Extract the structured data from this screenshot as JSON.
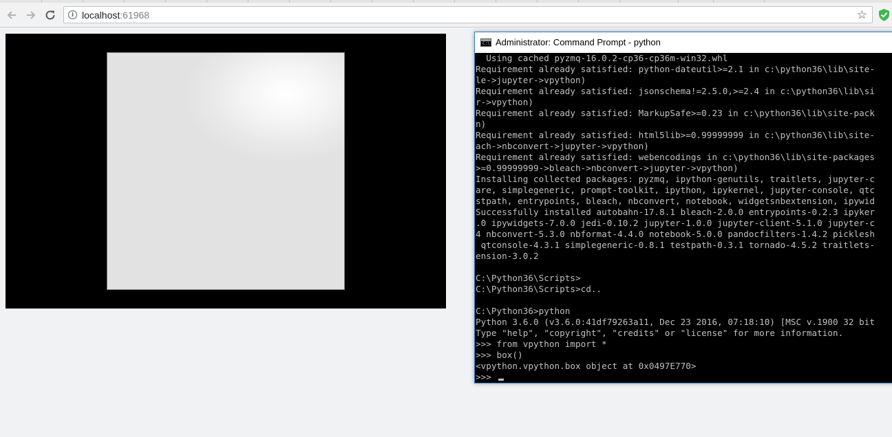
{
  "browser": {
    "address": {
      "host": "localhost",
      "port": ":61968"
    },
    "icons": {
      "back": "arrow-left-icon",
      "forward": "arrow-right-icon",
      "reload": "reload-icon",
      "info": "info-icon",
      "star": "star-icon",
      "extension": "shield-check-icon"
    }
  },
  "vpython_scene": {
    "background_color": "#000000",
    "object": "box",
    "object_color": "#e4e4e4"
  },
  "console": {
    "title": "Administrator: Command Prompt - python",
    "lines": [
      "  Using cached pyzmq-16.0.2-cp36-cp36m-win32.whl",
      "Requirement already satisfied: python-dateutil>=2.1 in c:\\python36\\lib\\site-",
      "le->jupyter->vpython)",
      "Requirement already satisfied: jsonschema!=2.5.0,>=2.4 in c:\\python36\\lib\\si",
      "r->vpython)",
      "Requirement already satisfied: MarkupSafe>=0.23 in c:\\python36\\lib\\site-pack",
      "n)",
      "Requirement already satisfied: html5lib>=0.99999999 in c:\\python36\\lib\\site-",
      "ach->nbconvert->jupyter->vpython)",
      "Requirement already satisfied: webencodings in c:\\python36\\lib\\site-packages",
      ">=0.99999999->bleach->nbconvert->jupyter->vpython)",
      "Installing collected packages: pyzmq, ipython-genutils, traitlets, jupyter-c",
      "are, simplegeneric, prompt-toolkit, ipython, ipykernel, jupyter-console, qtc",
      "stpath, entrypoints, bleach, nbconvert, notebook, widgetsnbextension, ipywid",
      "Successfully installed autobahn-17.8.1 bleach-2.0.0 entrypoints-0.2.3 ipyker",
      ".0 ipywidgets-7.0.0 jedi-0.10.2 jupyter-1.0.0 jupyter-client-5.1.0 jupyter-c",
      "4 nbconvert-5.3.0 nbformat-4.4.0 notebook-5.0.0 pandocfilters-1.4.2 picklesh",
      " qtconsole-4.3.1 simplegeneric-0.8.1 testpath-0.3.1 tornado-4.5.2 traitlets-",
      "ension-3.0.2",
      "",
      "C:\\Python36\\Scripts>",
      "C:\\Python36\\Scripts>cd..",
      "",
      "C:\\Python36>python",
      "Python 3.6.0 (v3.6.0:41df79263a11, Dec 23 2016, 07:18:10) [MSC v.1900 32 bit",
      "Type \"help\", \"copyright\", \"credits\" or \"license\" for more information.",
      ">>> from vpython import *",
      ">>> box()",
      "<vpython.vpython.box object at 0x0497E770>",
      ">>> "
    ],
    "text_color": "#c0c0c0",
    "background_color": "#000000"
  }
}
